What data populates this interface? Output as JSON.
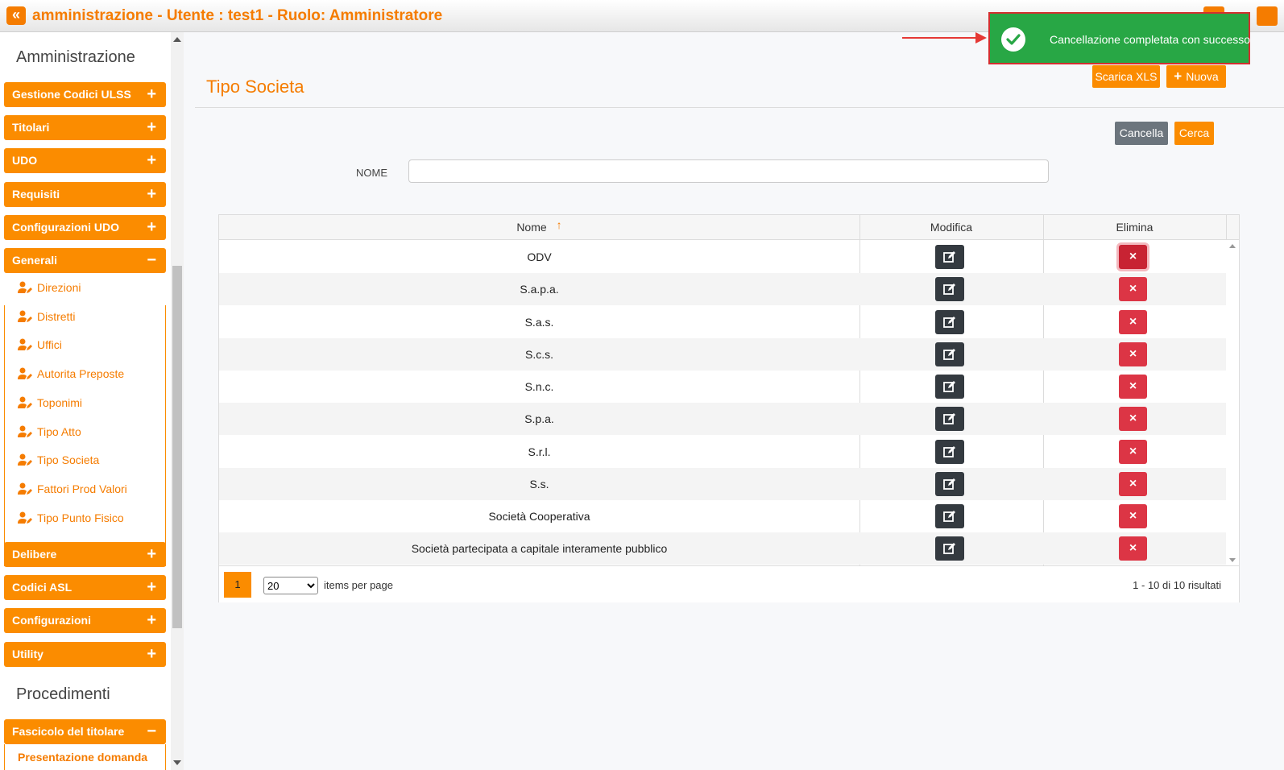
{
  "header": {
    "title": "amministrazione - Utente : test1 - Ruolo: Amministratore",
    "collapse_glyph": "«"
  },
  "toast": {
    "message": "Cancellazione completata con successo",
    "icon": "check-circle-icon",
    "color": "#28a745"
  },
  "sidebar": {
    "section_admin": "Amministrazione",
    "section_proc": "Procedimenti",
    "menu": [
      {
        "label": "Gestione Codici ULSS",
        "sign": "+"
      },
      {
        "label": "Titolari",
        "sign": "+"
      },
      {
        "label": "UDO",
        "sign": "+"
      },
      {
        "label": "Requisiti",
        "sign": "+"
      },
      {
        "label": "Configurazioni UDO",
        "sign": "+"
      },
      {
        "label": "Generali",
        "sign": "−"
      },
      {
        "label": "Delibere",
        "sign": "+"
      },
      {
        "label": "Codici ASL",
        "sign": "+"
      },
      {
        "label": "Configurazioni",
        "sign": "+"
      },
      {
        "label": "Utility",
        "sign": "+"
      },
      {
        "label": "Fascicolo del titolare",
        "sign": "−"
      }
    ],
    "sub_items": [
      {
        "label": "Direzioni"
      },
      {
        "label": "Distretti"
      },
      {
        "label": "Uffici"
      },
      {
        "label": "Autorita Preposte"
      },
      {
        "label": "Toponimi"
      },
      {
        "label": "Tipo Atto"
      },
      {
        "label": "Tipo Societa"
      },
      {
        "label": "Fattori Prod Valori"
      },
      {
        "label": "Tipo Punto Fisico"
      }
    ],
    "partial_item": "Presentazione domanda"
  },
  "main": {
    "title": "Tipo Societa",
    "btn_xls": "Scarica XLS",
    "btn_new": "Nuova",
    "btn_new_icon": "+",
    "btn_cancel": "Cancella",
    "btn_search": "Cerca",
    "filter_label": "NOME",
    "filter_value": ""
  },
  "grid": {
    "columns": {
      "name": "Nome",
      "edit": "Modifica",
      "delete": "Elimina"
    },
    "sort_indicator": "↑",
    "delete_glyph": "×",
    "rows": [
      {
        "name": "ODV"
      },
      {
        "name": "S.a.p.a."
      },
      {
        "name": "S.a.s."
      },
      {
        "name": "S.c.s."
      },
      {
        "name": "S.n.c."
      },
      {
        "name": "S.p.a."
      },
      {
        "name": "S.r.l."
      },
      {
        "name": "S.s."
      },
      {
        "name": "Società Cooperativa"
      },
      {
        "name": "Società partecipata a capitale interamente pubblico"
      }
    ],
    "pager": {
      "current_page": "1",
      "page_size": "20",
      "page_size_options": [
        "20"
      ],
      "items_label": "items per page",
      "info": "1 - 10 di 10 risultati"
    }
  },
  "colors": {
    "accent": "#fb8c00",
    "danger": "#dc3545",
    "dark": "#343a40",
    "success": "#28a745"
  }
}
